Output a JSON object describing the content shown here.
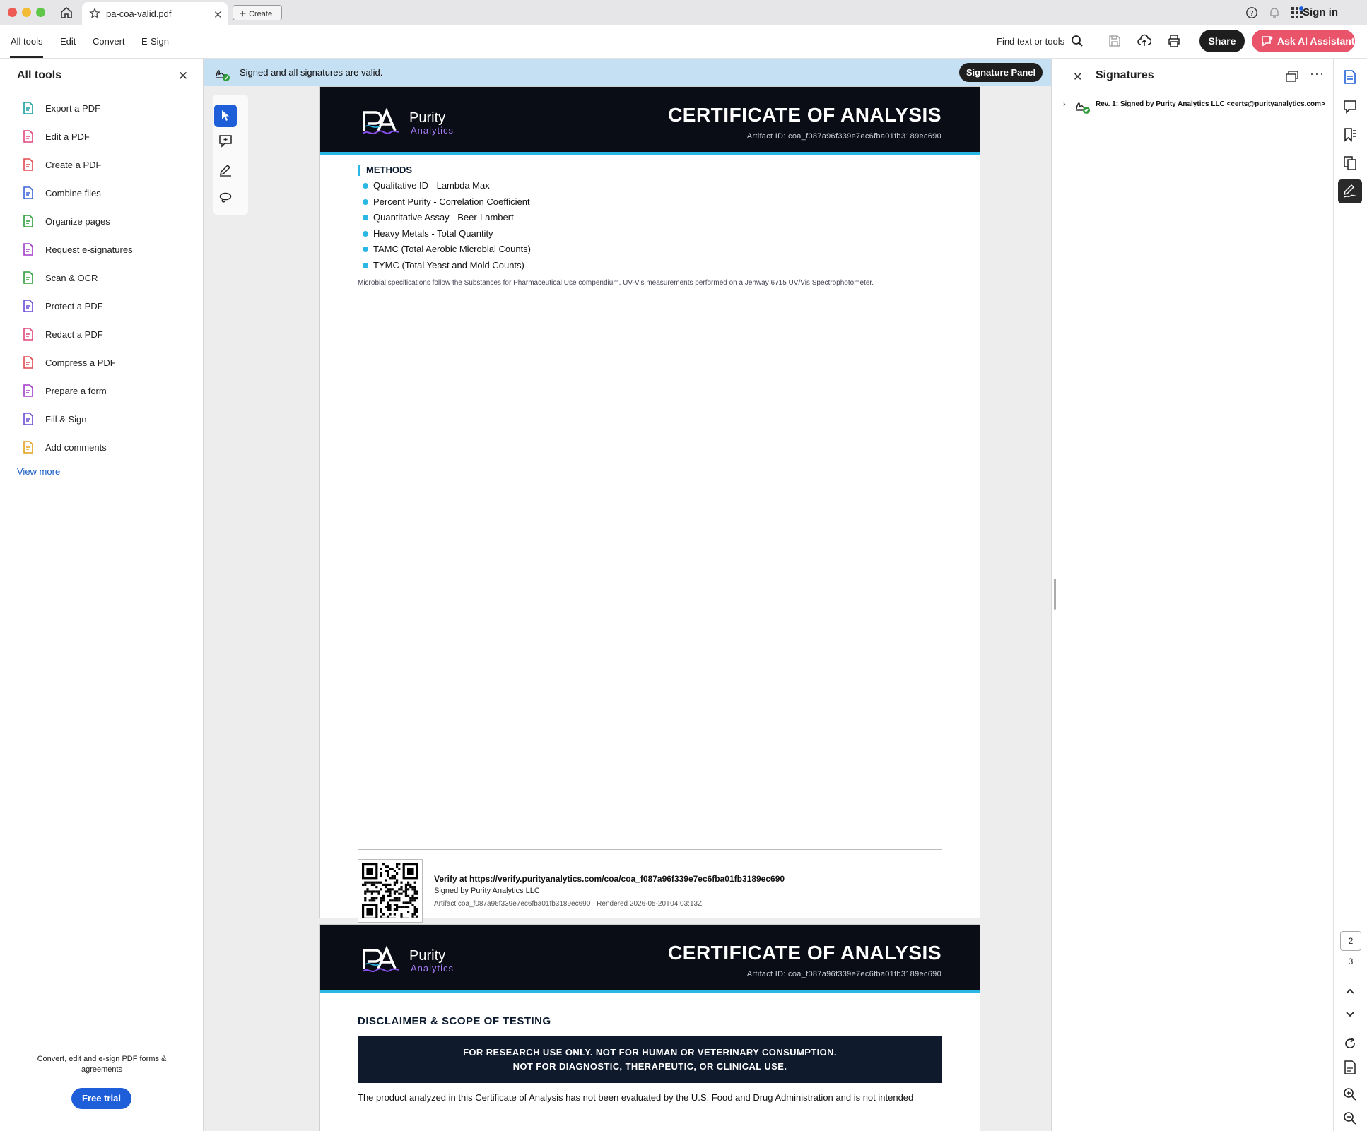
{
  "window": {
    "tab_title": "pa-coa-valid.pdf",
    "create_label": "Create",
    "sign_in": "Sign in"
  },
  "menubar": {
    "items": [
      "All tools",
      "Edit",
      "Convert",
      "E-Sign"
    ],
    "find": "Find text or tools",
    "share": "Share",
    "ask_ai": "Ask AI Assistant"
  },
  "left_panel": {
    "title": "All tools",
    "tools": [
      {
        "label": "Export a PDF",
        "icon": "export-pdf-icon",
        "color": "#1aa0a0"
      },
      {
        "label": "Edit a PDF",
        "icon": "edit-pdf-icon",
        "color": "#e0457b"
      },
      {
        "label": "Create a PDF",
        "icon": "create-pdf-icon",
        "color": "#e34850"
      },
      {
        "label": "Combine files",
        "icon": "combine-files-icon",
        "color": "#3b63d8"
      },
      {
        "label": "Organize pages",
        "icon": "organize-pages-icon",
        "color": "#2d9d3a"
      },
      {
        "label": "Request e-signatures",
        "icon": "request-esign-icon",
        "color": "#a23bc8"
      },
      {
        "label": "Scan & OCR",
        "icon": "scan-ocr-icon",
        "color": "#2d9d3a"
      },
      {
        "label": "Protect a PDF",
        "icon": "protect-pdf-icon",
        "color": "#6a4ad6"
      },
      {
        "label": "Redact a PDF",
        "icon": "redact-pdf-icon",
        "color": "#e0457b"
      },
      {
        "label": "Compress a PDF",
        "icon": "compress-pdf-icon",
        "color": "#e34850"
      },
      {
        "label": "Prepare a form",
        "icon": "prepare-form-icon",
        "color": "#a23bc8"
      },
      {
        "label": "Fill & Sign",
        "icon": "fill-sign-icon",
        "color": "#6a4ad6"
      },
      {
        "label": "Add comments",
        "icon": "add-comments-icon",
        "color": "#e3a21a"
      }
    ],
    "view_more": "View more",
    "promo": "Convert, edit and e-sign PDF forms & agreements",
    "free_trial": "Free trial"
  },
  "banner": {
    "text": "Signed and all signatures are valid.",
    "signature_panel": "Signature Panel"
  },
  "document": {
    "brand": "Purity",
    "brand_sub": "Analytics",
    "header_title": "CERTIFICATE OF ANALYSIS",
    "artifact_id": "Artifact ID: coa_f087a96f339e7ec6fba01fb3189ec690",
    "methods_heading": "METHODS",
    "methods": [
      "Qualitative ID - Lambda Max",
      "Percent Purity - Correlation Coefficient",
      "Quantitative Assay - Beer-Lambert",
      "Heavy Metals - Total Quantity",
      "TAMC (Total Aerobic Microbial Counts)",
      "TYMC (Total Yeast and Mold Counts)"
    ],
    "methods_note": "Microbial specifications follow the Substances for Pharmaceutical Use compendium. UV-Vis measurements performed on a Jenway 6715 UV/Vis Spectrophotometer.",
    "verify_url": "Verify at https://verify.purityanalytics.com/coa/coa_f087a96f339e7ec6fba01fb3189ec690",
    "signed_by": "Signed by Purity Analytics LLC",
    "rendered": "Artifact coa_f087a96f339e7ec6fba01fb3189ec690 · Rendered 2026-05-20T04:03:13Z",
    "disclaimer_heading": "DISCLAIMER & SCOPE OF TESTING",
    "disclaimer_line1": "FOR RESEARCH USE ONLY. NOT FOR HUMAN OR VETERINARY CONSUMPTION.",
    "disclaimer_line2": "NOT FOR DIAGNOSTIC, THERAPEUTIC, OR CLINICAL USE.",
    "disclaimer_text": "The product analyzed in this Certificate of Analysis has not been evaluated by the U.S. Food and Drug Administration and is not intended"
  },
  "signatures_panel": {
    "title": "Signatures",
    "entry": "Rev. 1: Signed by Purity Analytics LLC <certs@purityanalytics.com>"
  },
  "rail": {
    "page_current": "2",
    "page_next": "3"
  },
  "colors": {
    "accent_blue": "#1f5ed9",
    "ai_button": "#e9546b",
    "doc_header": "#0a0d16",
    "doc_accent": "#2bb7e4",
    "banner_bg": "#c5dff3"
  }
}
